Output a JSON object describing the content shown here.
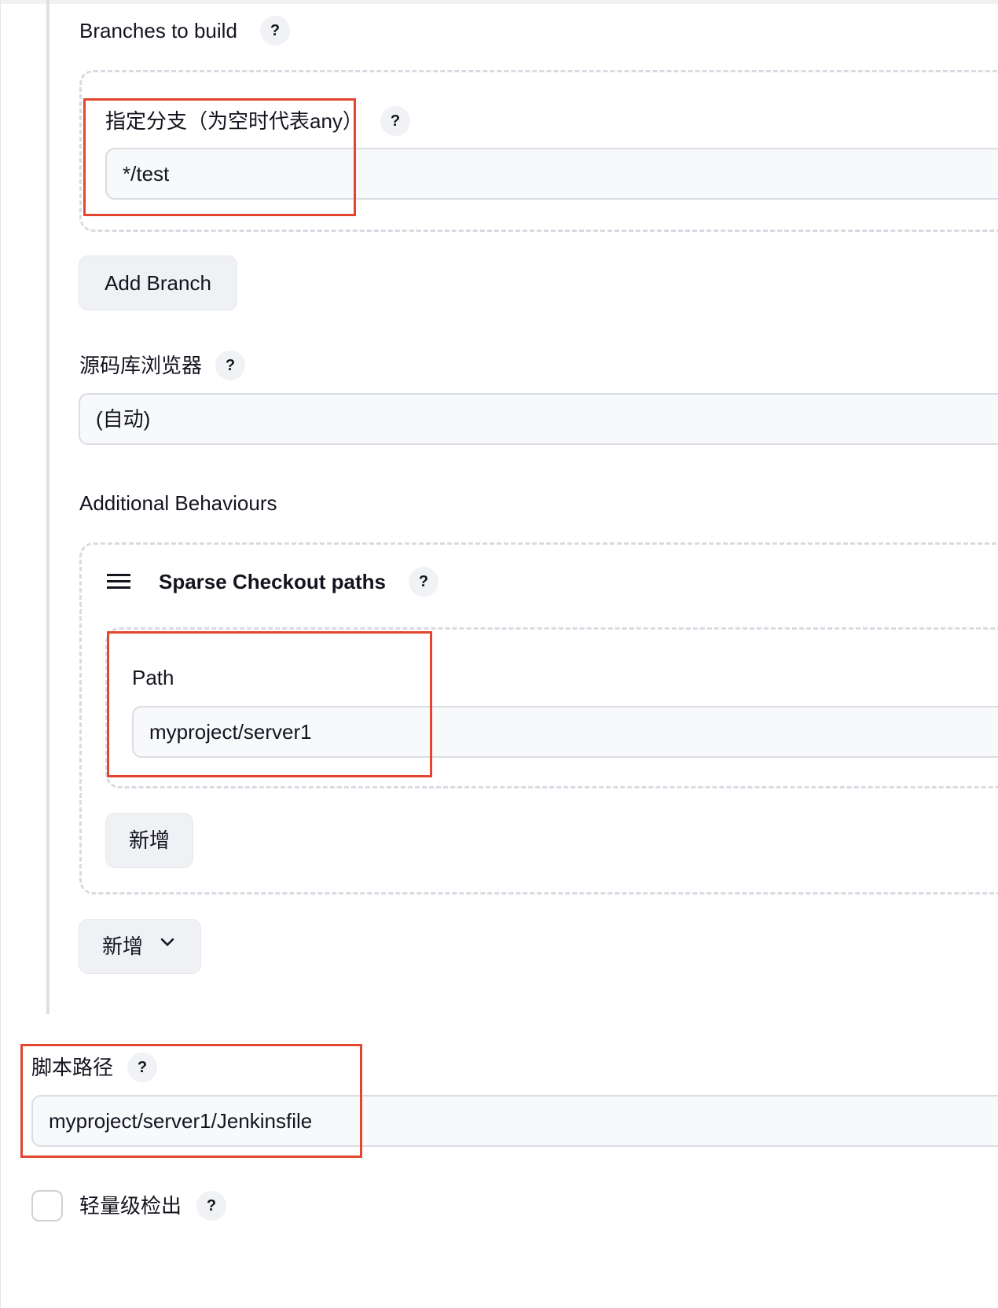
{
  "branches_section": {
    "label": "Branches to build",
    "branch_specifier_label": "指定分支（为空时代表any）",
    "branch_specifier_value": "*/test",
    "add_branch_label": "Add Branch"
  },
  "repo_browser": {
    "label": "源码库浏览器",
    "selected_value": "(自动)"
  },
  "additional_behaviours": {
    "label": "Additional Behaviours",
    "sparse_checkout": {
      "title": "Sparse Checkout paths",
      "path_label": "Path",
      "path_value": "myproject/server1",
      "add_label": "新增"
    },
    "add_dropdown_label": "新增"
  },
  "script_path": {
    "label": "脚本路径",
    "value": "myproject/server1/Jenkinsfile"
  },
  "lightweight_checkout": {
    "label": "轻量级检出",
    "checked": false
  },
  "help_glyph": "?",
  "icons": [
    "help-icon",
    "drag-handle-icon",
    "chevron-down-icon"
  ],
  "colors": {
    "highlight": "#e2462f",
    "field_bg": "#f8f9fb",
    "button_bg": "#f0f1f4",
    "dashed_border": "#d9dbe2"
  }
}
